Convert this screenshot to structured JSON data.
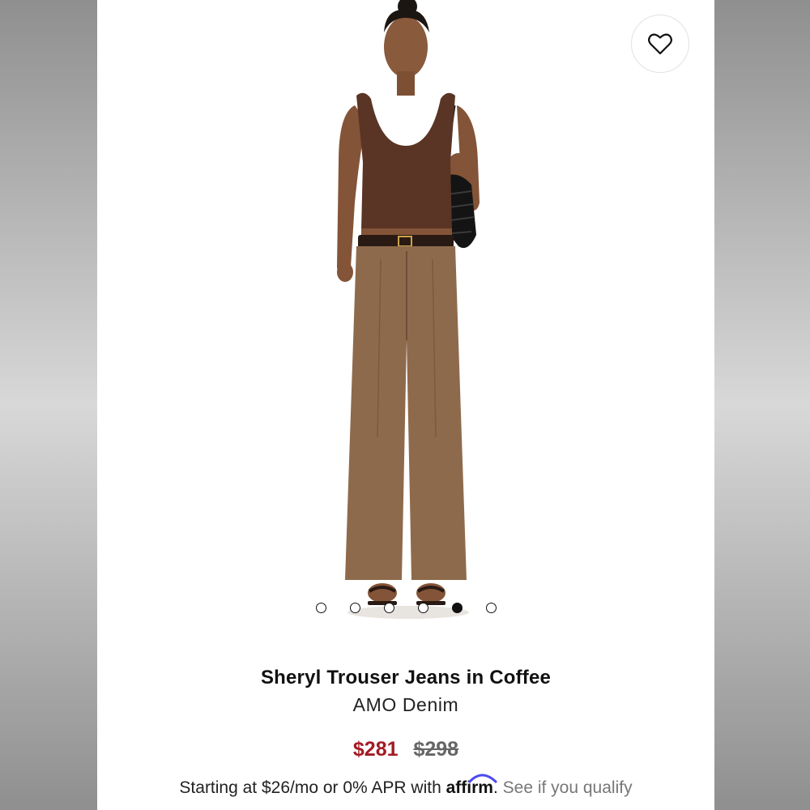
{
  "product": {
    "name": "Sheryl Trouser Jeans in Coffee",
    "brand": "AMO Denim",
    "sale_price": "$281",
    "original_price": "$298"
  },
  "financing": {
    "prefix": "Starting at $26/mo or 0% APR with",
    "provider": "affirm",
    "suffix": ".",
    "link": "See if you qualify"
  },
  "gallery": {
    "total_images": 6,
    "active_index": 5
  },
  "icons": {
    "wishlist": "heart-outline-icon"
  },
  "colors": {
    "sale_price": "#a31b24",
    "original_price": "#666666",
    "top": "#5a3424",
    "pants": "#8e6a4c"
  }
}
